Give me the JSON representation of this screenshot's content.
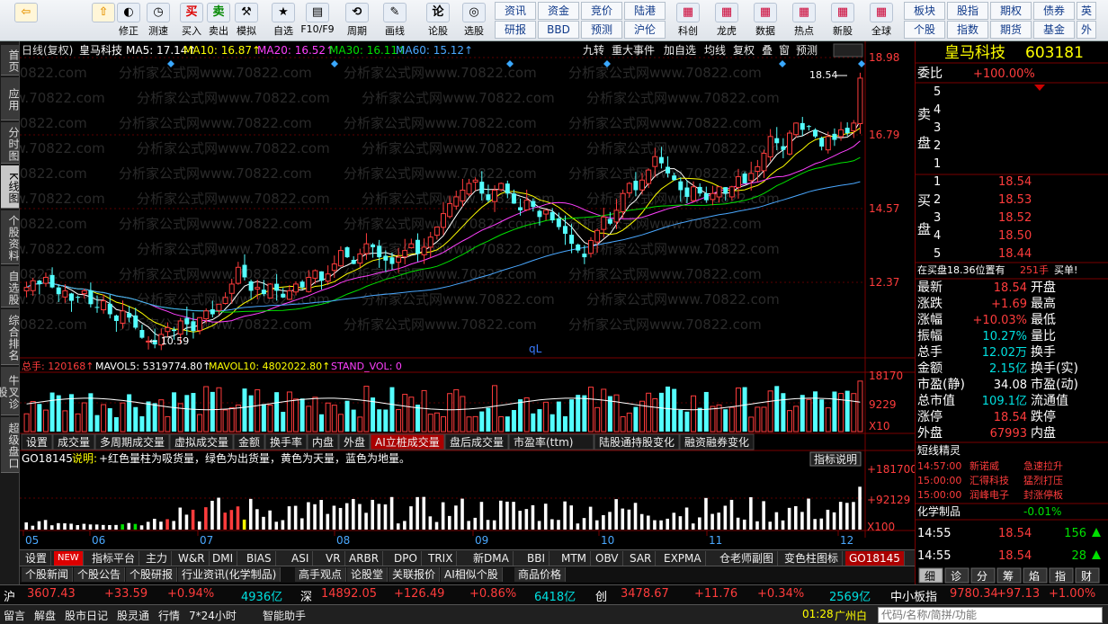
{
  "toolbar": {
    "buttons": [
      {
        "name": "back",
        "label": "",
        "icon": "back-arrow-icon"
      },
      {
        "name": "home",
        "label": "",
        "icon": "up-arrow-icon"
      },
      {
        "name": "fix",
        "label": "修正",
        "icon": "fix-icon"
      },
      {
        "name": "clock",
        "label": "测速",
        "icon": "clock-icon"
      },
      {
        "name": "buy",
        "label": "买入",
        "icon": "buy-icon"
      },
      {
        "name": "sell",
        "label": "卖出",
        "icon": "sell-icon"
      },
      {
        "name": "sim",
        "label": "模拟",
        "icon": "hammer-icon"
      },
      {
        "name": "optional",
        "label": "自选",
        "icon": "star-icon"
      },
      {
        "name": "f10",
        "label": "F10/F9",
        "icon": "f10-icon"
      },
      {
        "name": "period",
        "label": "周期",
        "icon": "period-icon"
      },
      {
        "name": "draw",
        "label": "画线",
        "icon": "pencil-icon"
      },
      {
        "name": "lunshi",
        "label": "论股",
        "icon": "lun-icon"
      },
      {
        "name": "select",
        "label": "选股",
        "icon": "select-icon"
      }
    ],
    "text_buttons_row1": [
      "资讯",
      "资金",
      "竞价",
      "陆港"
    ],
    "text_buttons_row2": [
      "研报",
      "BBD",
      "预测",
      "沪伦"
    ],
    "big_buttons": [
      {
        "name": "kechuang",
        "label": "科创"
      },
      {
        "name": "longhu",
        "label": "龙虎"
      },
      {
        "name": "shuju",
        "label": "数据"
      },
      {
        "name": "redian",
        "label": "热点"
      },
      {
        "name": "xingu",
        "label": "新股"
      },
      {
        "name": "quanqiu",
        "label": "全球"
      }
    ],
    "right_buttons_row1": [
      "板块",
      "股指",
      "期权",
      "债券",
      "英"
    ],
    "right_buttons_row2": [
      "个股",
      "指数",
      "期货",
      "基金",
      "外"
    ]
  },
  "left_nav": [
    "首页",
    "应用",
    "分时图",
    "K线图",
    "个股资料",
    "自选股",
    "综合排名",
    "牛叉诊股",
    "超级盘口"
  ],
  "chart_header": {
    "period_label": "日线(复权)",
    "stock_name": "皇马科技",
    "ma5": "MA5: 17.14↑",
    "ma10": "MA10: 16.87↑",
    "ma20": "MA20: 16.52↑",
    "ma30": "MA30: 16.11↑",
    "ma60": "MA60: 15.12↑",
    "tools": [
      "九转",
      "重大事件",
      "加自选",
      "均线",
      "复权",
      "叠",
      "窗",
      "预测"
    ]
  },
  "watermark_text": "分析家公式网www.70822.com",
  "price_axis": [
    "18.98",
    "16.79",
    "14.57",
    "12.37"
  ],
  "price_annotations": {
    "high": "18.54",
    "low": "10.59",
    "marker": "qL"
  },
  "volume_header": {
    "total": "总手: 120168↑",
    "mavol5": "MAVOL5: 5319774.80↑",
    "mavol10": "MAVOL10: 4802022.80↑",
    "stand": "STAND_VOL: 0"
  },
  "volume_axis": [
    "18170",
    "9229",
    "X10"
  ],
  "indicator_tabs": [
    "设置",
    "成交量",
    "多周期成交量",
    "虚拟成交量",
    "金额",
    "换手率",
    "内盘",
    "外盘",
    "AI立桩成交量",
    "盘后成交量",
    "市盈率(ttm)",
    "陆股通持股变化",
    "融资融券变化"
  ],
  "indicator_active": "AI立桩成交量",
  "go_header": {
    "name": "GO18145",
    "desc_prefix": "说明:",
    "desc": "+红色量柱为吸货量，绿色为出货量，黄色为天量，蓝色为地量。",
    "explain_button": "指标说明"
  },
  "go_axis": [
    "+181700",
    "+92129",
    "X100"
  ],
  "month_labels": [
    "05",
    "06",
    "07",
    "08",
    "09",
    "10",
    "11",
    "12"
  ],
  "bottom_tabs": [
    "设置",
    "NEW",
    "指标平台",
    "主力",
    "W&R",
    "DMI",
    "BIAS",
    "ASI",
    "VR",
    "ARBR",
    "DPO",
    "TRIX",
    "新DMA",
    "BBI",
    "MTM",
    "OBV",
    "SAR",
    "EXPMA",
    "仓老师副图",
    "变色柱图标",
    "GO18145"
  ],
  "info_tabs": [
    "个股新闻",
    "个股公告",
    "个股研报",
    "行业资讯(化学制品)",
    "高手观点",
    "论股堂",
    "关联报价",
    "AI相似个股",
    "商品价格"
  ],
  "right_panel": {
    "name": "皇马科技",
    "code": "603181",
    "weibi_label": "委比",
    "weibi": "+100.00%",
    "sell_label": "卖盘",
    "buy_label": "买盘",
    "sell": [
      {
        "n": "5",
        "p": "",
        "v": ""
      },
      {
        "n": "4",
        "p": "",
        "v": ""
      },
      {
        "n": "3",
        "p": "",
        "v": ""
      },
      {
        "n": "2",
        "p": "",
        "v": ""
      },
      {
        "n": "1",
        "p": "",
        "v": ""
      }
    ],
    "buy": [
      {
        "n": "1",
        "p": "18.54"
      },
      {
        "n": "2",
        "p": "18.53"
      },
      {
        "n": "3",
        "p": "18.52"
      },
      {
        "n": "4",
        "p": "18.50"
      },
      {
        "n": "5",
        "p": "18.44"
      }
    ],
    "note": "在买盘18.36位置有",
    "note_vol": "251手",
    "note_tail": "买单!",
    "stats": [
      {
        "l": "最新",
        "v": "18.54",
        "c": "red",
        "l2": "开盘",
        "v2": ""
      },
      {
        "l": "涨跌",
        "v": "+1.69",
        "c": "red",
        "l2": "最高",
        "v2": ""
      },
      {
        "l": "涨幅",
        "v": "+10.03%",
        "c": "red",
        "l2": "最低",
        "v2": ""
      },
      {
        "l": "振幅",
        "v": "10.27%",
        "c": "cyn",
        "l2": "量比",
        "v2": ""
      },
      {
        "l": "总手",
        "v": "12.02万",
        "c": "cyn",
        "l2": "换手",
        "v2": ""
      },
      {
        "l": "金额",
        "v": "2.15亿",
        "c": "cyn",
        "l2": "换手(实)",
        "v2": ""
      },
      {
        "l": "市盈(静)",
        "v": "34.08",
        "c": "wht",
        "l2": "市盈(动)",
        "v2": ""
      },
      {
        "l": "总市值",
        "v": "109.1亿",
        "c": "cyn",
        "l2": "流通值",
        "v2": ""
      },
      {
        "l": "涨停",
        "v": "18.54",
        "c": "red",
        "l2": "跌停",
        "v2": ""
      },
      {
        "l": "外盘",
        "v": "67993",
        "c": "red",
        "l2": "内盘",
        "v2": ""
      }
    ],
    "sprite_title": "短线精灵",
    "sprites": [
      {
        "t": "14:57:00",
        "n": "新诺威",
        "e": "急速拉升"
      },
      {
        "t": "15:00:00",
        "n": "汇得科技",
        "e": "猛烈打压"
      },
      {
        "t": "15:00:00",
        "n": "润峰电子",
        "e": "封涨停板"
      }
    ],
    "industry": "化学制品",
    "industry_chg": "-0.01%",
    "ticks": [
      {
        "t": "14:55",
        "p": "18.54",
        "v": "156",
        "arrow": "up"
      },
      {
        "t": "14:55",
        "p": "18.54",
        "v": "28",
        "arrow": "up"
      }
    ],
    "bottom_tabs": [
      "细",
      "诊",
      "分",
      "筹",
      "焰",
      "指",
      "财"
    ]
  },
  "status": {
    "sh": {
      "name": "沪",
      "price": "3607.43",
      "chg": "+33.59",
      "pct": "+0.94%",
      "amt": "4936亿"
    },
    "sz": {
      "name": "深",
      "price": "14892.05",
      "chg": "+126.49",
      "pct": "+0.86%",
      "amt": "6418亿"
    },
    "cy": {
      "name": "创",
      "price": "3478.67",
      "chg": "+11.76",
      "pct": "+0.34%",
      "amt": "2569亿"
    },
    "zx": {
      "name": "中小板指",
      "price": "9780.34",
      "chg": "+97.13",
      "pct": "+1.00%"
    },
    "row2": [
      "留言",
      "解盘",
      "股市日记",
      "股灵通",
      "行情",
      "7*24小时",
      "智能助手"
    ],
    "time": "01:28",
    "city": "广州白",
    "search_placeholder": "代码/名称/简拼/功能"
  },
  "chart_data": {
    "type": "candlestick",
    "title": "皇马科技 日线(复权)",
    "x_months": [
      "05",
      "06",
      "07",
      "08",
      "09",
      "10",
      "11",
      "12"
    ],
    "ylim": [
      10.2,
      19.1
    ],
    "indicators": {
      "MA5": 17.14,
      "MA10": 16.87,
      "MA20": 16.52,
      "MA30": 16.11,
      "MA60": 15.12
    },
    "closes": [
      12.3,
      12.5,
      12.4,
      12.6,
      12.3,
      12.1,
      12.2,
      11.9,
      12.0,
      12.2,
      11.8,
      11.7,
      11.9,
      11.5,
      11.3,
      11.6,
      11.4,
      11.1,
      10.8,
      10.7,
      10.6,
      10.9,
      11.1,
      11.0,
      11.3,
      11.2,
      11.0,
      11.4,
      11.6,
      11.5,
      11.8,
      12.0,
      12.4,
      12.9,
      12.6,
      12.2,
      12.3,
      12.1,
      12.4,
      12.2,
      12.0,
      12.2,
      12.4,
      12.3,
      12.6,
      12.8,
      12.5,
      12.7,
      13.0,
      13.4,
      13.2,
      13.0,
      13.3,
      13.6,
      13.5,
      13.2,
      13.1,
      13.0,
      13.2,
      13.4,
      13.6,
      13.3,
      13.5,
      13.8,
      14.1,
      14.5,
      14.8,
      15.0,
      15.2,
      15.4,
      15.5,
      15.1,
      14.9,
      15.2,
      15.4,
      15.1,
      14.8,
      14.6,
      14.9,
      14.7,
      14.4,
      14.6,
      14.3,
      14.1,
      13.9,
      13.6,
      13.4,
      13.2,
      13.7,
      14.0,
      14.4,
      14.2,
      14.6,
      15.1,
      15.4,
      15.2,
      15.5,
      15.8,
      16.2,
      16.0,
      15.7,
      15.5,
      15.2,
      15.0,
      15.3,
      15.1,
      14.9,
      15.1,
      15.3,
      15.1,
      15.3,
      15.6,
      15.4,
      15.7,
      15.9,
      16.3,
      16.8,
      16.6,
      16.4,
      16.9,
      17.2,
      17.0,
      17.1,
      16.8,
      16.5,
      16.8,
      16.7,
      17.0,
      16.9,
      17.2,
      18.54
    ],
    "volume_max": 18170,
    "go_max": 181700,
    "annotations": {
      "high": 18.54,
      "low": 10.59
    }
  }
}
